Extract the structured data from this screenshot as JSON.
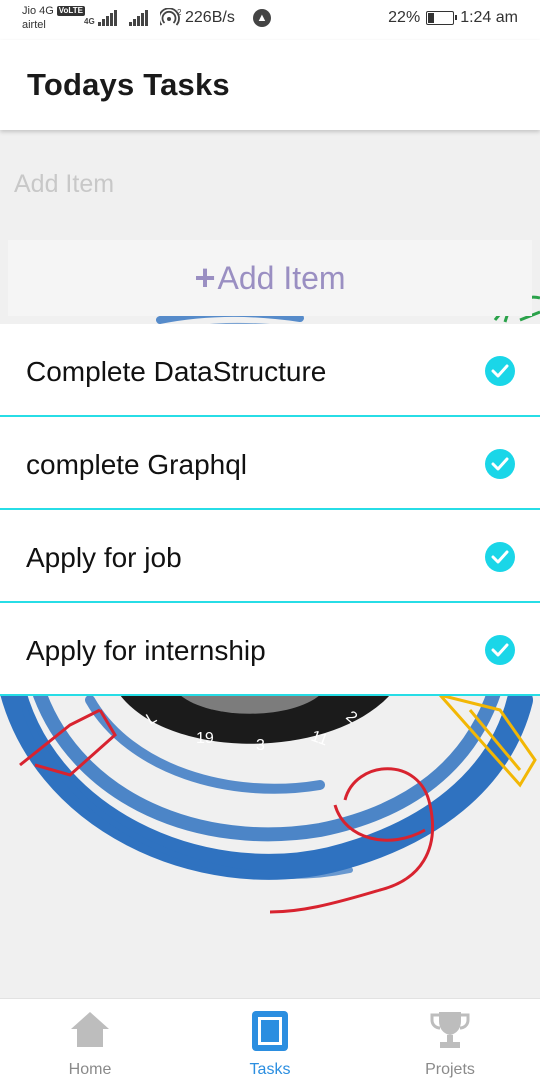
{
  "status_bar": {
    "carrier_line1": "Jio 4G",
    "volte": "VoLTE",
    "carrier_line2": "airtel",
    "net_type": "4G",
    "speed": "226B/s",
    "battery_text": "22%",
    "battery_level": 0.22,
    "time": "1:24 am"
  },
  "header": {
    "title": "Todays Tasks"
  },
  "add_form": {
    "input_placeholder": "Add Item",
    "input_value": "",
    "button_label": "Add Item",
    "button_icon": "plus-icon"
  },
  "tasks": [
    {
      "text": "Complete DataStructure",
      "done": true
    },
    {
      "text": "complete Graphql",
      "done": true
    },
    {
      "text": "Apply for job",
      "done": true
    },
    {
      "text": "Apply for internship",
      "done": true
    }
  ],
  "bottom_nav": {
    "items": [
      {
        "label": "Home",
        "icon": "home-icon",
        "active": false
      },
      {
        "label": "Tasks",
        "icon": "tasks-icon",
        "active": true
      },
      {
        "label": "Projets",
        "icon": "trophy-icon",
        "active": false
      }
    ]
  },
  "colors": {
    "accent": "#2b8ee0",
    "check": "#1ad6e8",
    "divider": "#27dde6",
    "button_text": "#9a8fc2",
    "art_blue": "#2f72c0",
    "art_red": "#d8232f",
    "art_green": "#2aa24a",
    "art_yellow": "#f2b705"
  }
}
